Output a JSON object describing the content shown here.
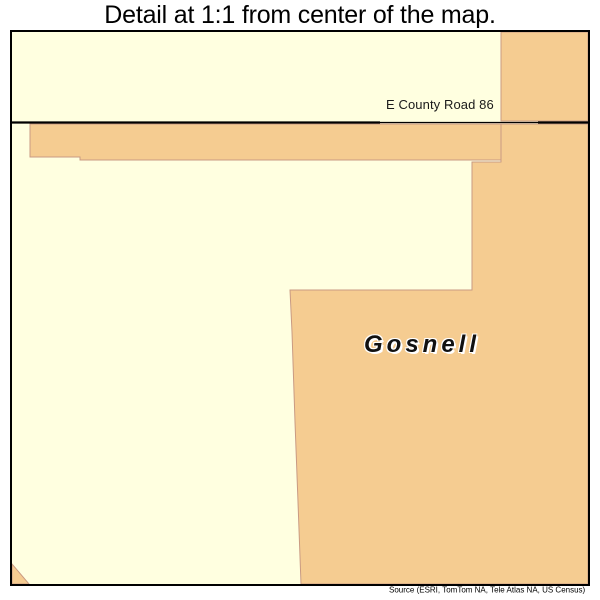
{
  "title": "Detail at 1:1 from center of the map.",
  "map": {
    "place_label": "Gosnell",
    "road_label": "E County Road 86",
    "source_credit": "Source (ESRI, TomTom NA, Tele Atlas NA, US Census)",
    "colors": {
      "place_fill": "#f5cc91",
      "place_outline": "#c99a82",
      "background_fill": "#ffffe0",
      "frame_stroke": "#000000",
      "road_stroke": "#000000"
    }
  },
  "chart_data": {
    "type": "map",
    "title": "Detail at 1:1 from center of the map.",
    "features": [
      {
        "name": "Gosnell",
        "kind": "city-limits-polygon",
        "fill": "#f5cc91",
        "outline": "#c99a82"
      },
      {
        "name": "E County Road 86",
        "kind": "road-line",
        "stroke": "#000000",
        "orientation": "horizontal"
      }
    ]
  }
}
